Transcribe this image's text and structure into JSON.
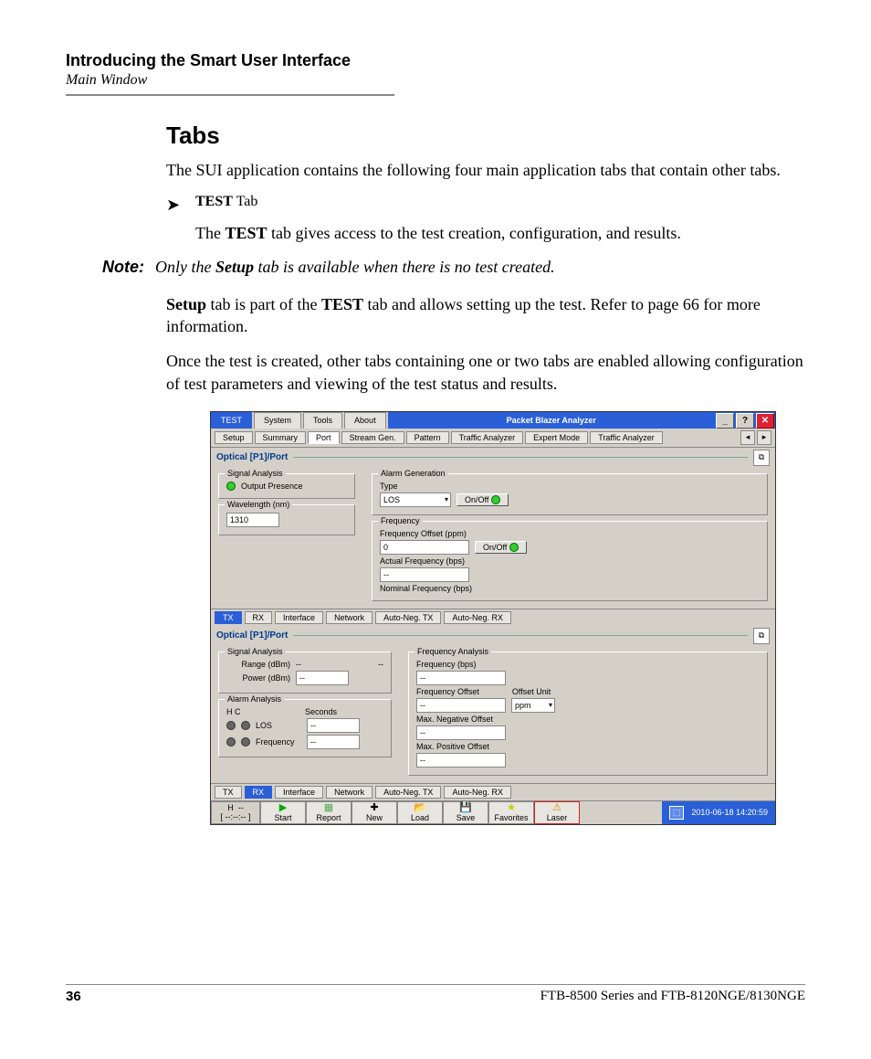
{
  "header": {
    "chapter": "Introducing the Smart User Interface",
    "subtitle": "Main Window"
  },
  "heading": "Tabs",
  "intro": "The SUI application contains the following four main application tabs that contain other tabs.",
  "bullet": {
    "label_bold": "TEST",
    "label_rest": " Tab",
    "desc_pre": "The ",
    "desc_bold": "TEST",
    "desc_post": " tab gives access to the test creation, configuration, and results."
  },
  "note": {
    "label": "Note:",
    "text_pre": "Only the ",
    "text_bold": "Setup",
    "text_post": " tab is available when there is no test created."
  },
  "para2": {
    "b1": "Setup",
    "t1": " tab is part of the ",
    "b2": "TEST",
    "t2": " tab and allows setting up the test. Refer to page 66 for more information."
  },
  "para3": "Once the test is created, other tabs containing one or two tabs are enabled allowing configuration of test parameters and viewing of the test status and results.",
  "app": {
    "title": "Packet Blazer Analyzer",
    "main_tabs": [
      "TEST",
      "System",
      "Tools",
      "About"
    ],
    "sub_tabs": [
      "Setup",
      "Summary",
      "Port",
      "Stream Gen.",
      "Pattern",
      "Traffic Analyzer",
      "Expert Mode",
      "Traffic Analyzer"
    ],
    "section_label": "Optical [P1]/Port",
    "tx_panel": {
      "signal_analysis": {
        "legend": "Signal Analysis",
        "output_presence": "Output Presence"
      },
      "wavelength": {
        "legend": "Wavelength (nm)",
        "value": "1310"
      },
      "alarm_gen": {
        "legend": "Alarm Generation",
        "type_label": "Type",
        "type_value": "LOS",
        "onoff": "On/Off"
      },
      "frequency": {
        "legend": "Frequency",
        "offset_label": "Frequency Offset (ppm)",
        "offset_value": "0",
        "onoff": "On/Off",
        "actual_label": "Actual Frequency (bps)",
        "actual_value": "--",
        "nominal_label": "Nominal Frequency (bps)"
      },
      "bottom_tabs": [
        "TX",
        "RX",
        "Interface",
        "Network",
        "Auto-Neg. TX",
        "Auto-Neg. RX"
      ]
    },
    "rx_panel": {
      "signal_analysis": {
        "legend": "Signal Analysis",
        "range_label": "Range (dBm)",
        "range_v1": "--",
        "range_v2": "--",
        "power_label": "Power (dBm)",
        "power_value": "--"
      },
      "alarm_analysis": {
        "legend": "Alarm Analysis",
        "hc": "H   C",
        "seconds": "Seconds",
        "los": "LOS",
        "los_value": "--",
        "freq": "Frequency",
        "freq_value": "--"
      },
      "freq_analysis": {
        "legend": "Frequency Analysis",
        "freq_bps": "Frequency (bps)",
        "freq_bps_value": "--",
        "freq_offset": "Frequency Offset",
        "freq_offset_value": "--",
        "offset_unit_label": "Offset Unit",
        "offset_unit_value": "ppm",
        "max_neg": "Max. Negative Offset",
        "max_neg_value": "--",
        "max_pos": "Max. Positive Offset",
        "max_pos_value": "--"
      },
      "bottom_tabs": [
        "TX",
        "RX",
        "Interface",
        "Network",
        "Auto-Neg. TX",
        "Auto-Neg. RX"
      ]
    },
    "toolbar": {
      "status_h": "H",
      "status_dash": "--",
      "status_time": "[   --:--:--   ]",
      "start": "Start",
      "report": "Report",
      "new": "New",
      "load": "Load",
      "save": "Save",
      "favorites": "Favorites",
      "laser": "Laser"
    },
    "statusbar": {
      "timestamp": "2010-06-18 14:20:59"
    }
  },
  "footer": {
    "page": "36",
    "product": "FTB-8500 Series and FTB-8120NGE/8130NGE"
  }
}
